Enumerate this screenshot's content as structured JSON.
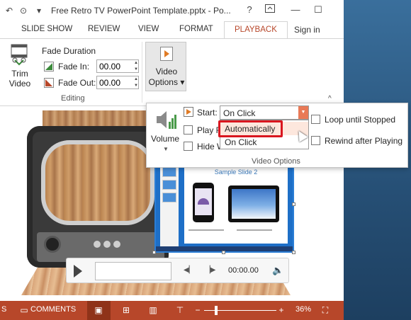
{
  "window": {
    "title": "Free Retro TV PowerPoint Template.pptx - Po...",
    "help": "?",
    "restore_icon": "ribbon-display-icon",
    "minimize": "—",
    "maximize": "☐"
  },
  "tabs": {
    "slide_show": "SLIDE SHOW",
    "review": "REVIEW",
    "view": "VIEW",
    "format": "FORMAT",
    "playback": "PLAYBACK",
    "sign_in": "Sign in"
  },
  "ribbon": {
    "trim_label": "Trim Video",
    "fade_duration": "Fade Duration",
    "fade_in_label": "Fade In:",
    "fade_in_value": "00.00",
    "fade_out_label": "Fade Out:",
    "fade_out_value": "00.00",
    "editing_group": "Editing",
    "video_options_label": "Video Options",
    "video_options_caret": "▾"
  },
  "popup": {
    "volume_label": "Volume",
    "start_label": "Start:",
    "start_value": "On Click",
    "play_full_label": "Play F",
    "hide_label": "Hide W",
    "loop_label": "Loop until Stopped",
    "rewind_label": "Rewind after Playing",
    "dropdown_options": [
      "Automatically",
      "On Click"
    ],
    "group_label": "Video Options"
  },
  "video_slide": {
    "title": "Sample Slide 2"
  },
  "controls": {
    "time": "00:00.00"
  },
  "statusbar": {
    "comments": "COMMENTS",
    "zoom": "36%"
  },
  "colors": {
    "accent": "#b7472a",
    "dropdown_highlight": "#d9161f",
    "playback_tab_text": "#b7472a"
  }
}
